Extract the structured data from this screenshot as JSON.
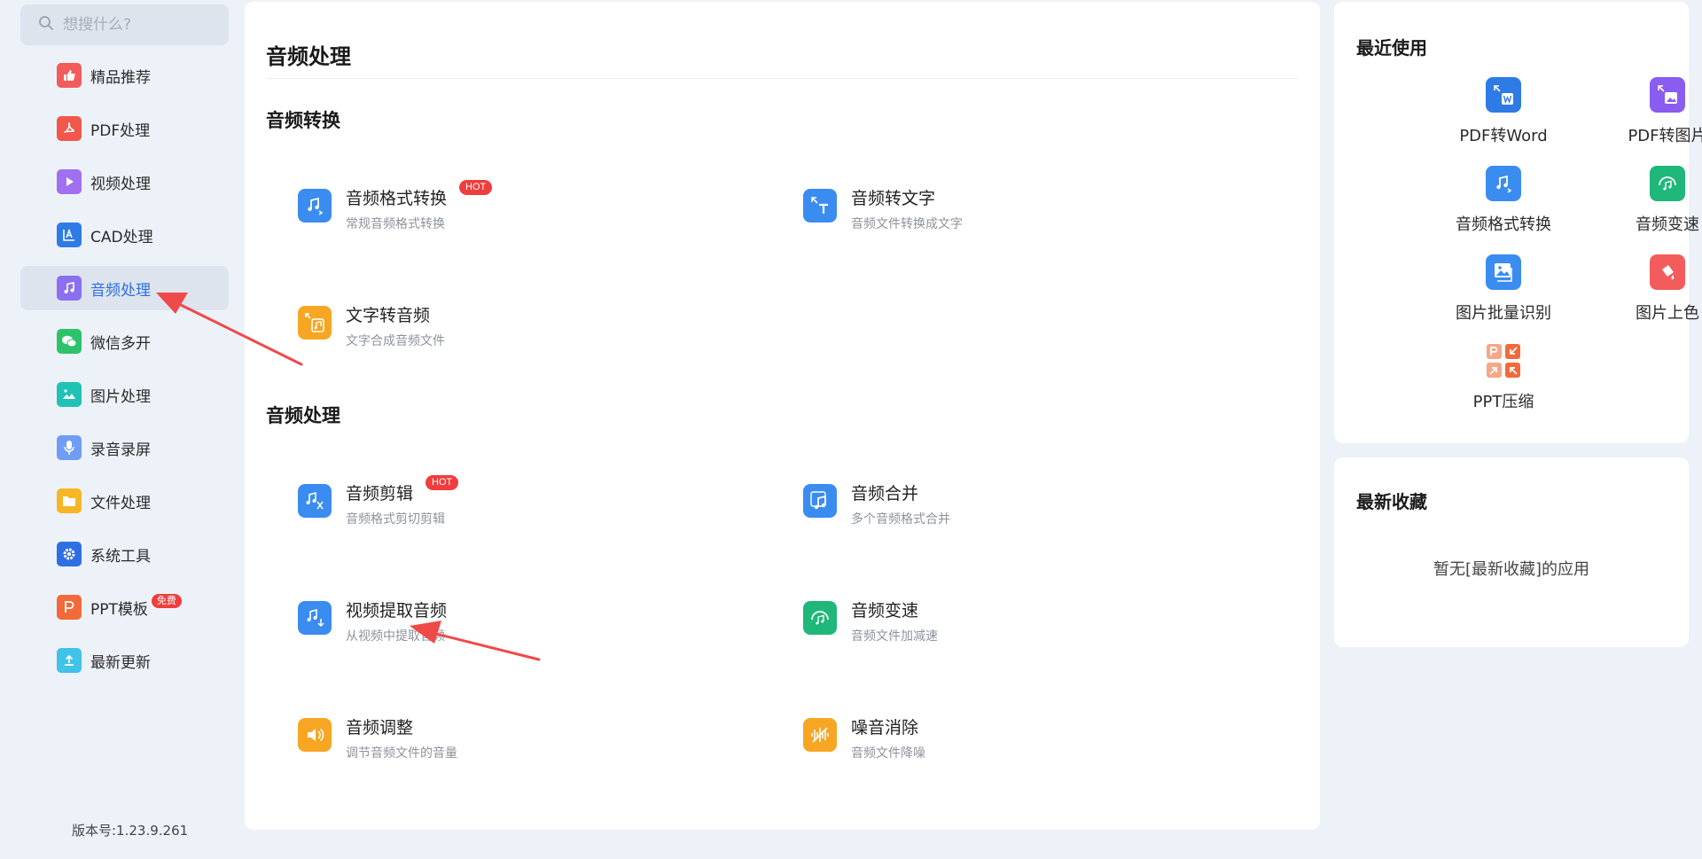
{
  "search": {
    "placeholder": "想搜什么?"
  },
  "sidebar": {
    "items": [
      {
        "label": "精品推荐",
        "icon": "thumbs-up-icon",
        "color": "#f25c5c"
      },
      {
        "label": "PDF处理",
        "icon": "pdf-icon",
        "color": "#f2574b"
      },
      {
        "label": "视频处理",
        "icon": "play-icon",
        "color": "#a070f0"
      },
      {
        "label": "CAD处理",
        "icon": "cad-icon",
        "color": "#2f7be6"
      },
      {
        "label": "音频处理",
        "icon": "music-icon",
        "color": "#8a6ff0",
        "active": true
      },
      {
        "label": "微信多开",
        "icon": "wechat-icon",
        "color": "#2ec36b"
      },
      {
        "label": "图片处理",
        "icon": "image-icon",
        "color": "#20c2b5"
      },
      {
        "label": "录音录屏",
        "icon": "microphone-icon",
        "color": "#6f9cf5"
      },
      {
        "label": "文件处理",
        "icon": "folder-icon",
        "color": "#f7b626"
      },
      {
        "label": "系统工具",
        "icon": "gear-icon",
        "color": "#2f6fe4"
      },
      {
        "label": "PPT模板",
        "icon": "ppt-icon",
        "color": "#f26a3a",
        "badge": "免费"
      },
      {
        "label": "最新更新",
        "icon": "upload-icon",
        "color": "#3fc3e8"
      }
    ],
    "version": "版本号:1.23.9.261"
  },
  "main": {
    "title": "音频处理",
    "sections": [
      {
        "title": "音频转换",
        "tools": [
          {
            "name": "音频格式转换",
            "desc": "常规音频格式转换",
            "badge": "HOT",
            "icon": "audio-convert-icon",
            "color": "#3a8cf0"
          },
          {
            "name": "音频转文字",
            "desc": "音频文件转换成文字",
            "icon": "audio-to-text-icon",
            "color": "#3a8cf0"
          },
          {
            "name": "文字转音频",
            "desc": "文字合成音频文件",
            "icon": "text-to-audio-icon",
            "color": "#f7a623"
          }
        ]
      },
      {
        "title": "音频处理",
        "tools": [
          {
            "name": "音频剪辑",
            "desc": "音频格式剪切剪辑",
            "badge": "HOT",
            "icon": "audio-cut-icon",
            "color": "#3a8cf0"
          },
          {
            "name": "音频合并",
            "desc": "多个音频格式合并",
            "icon": "audio-merge-icon",
            "color": "#3a8cf0"
          },
          {
            "name": "视频提取音频",
            "desc": "从视频中提取音频",
            "icon": "video-extract-audio-icon",
            "color": "#3a8cf0"
          },
          {
            "name": "音频变速",
            "desc": "音频文件加减速",
            "icon": "audio-speed-icon",
            "color": "#1fb77a"
          },
          {
            "name": "音频调整",
            "desc": "调节音频文件的音量",
            "icon": "volume-icon",
            "color": "#f7a623"
          },
          {
            "name": "噪音消除",
            "desc": "音频文件降噪",
            "icon": "noise-reduce-icon",
            "color": "#f7a623"
          }
        ]
      }
    ]
  },
  "recent": {
    "title": "最近使用",
    "items": [
      {
        "label": "PDF转Word",
        "icon": "pdf-to-word-icon",
        "color": "#2f7be6"
      },
      {
        "label": "PDF转图片",
        "icon": "pdf-to-image-icon",
        "color": "#8a5cf0"
      },
      {
        "label": "音频格式转换",
        "icon": "audio-convert-icon",
        "color": "#3a8cf0"
      },
      {
        "label": "音频变速",
        "icon": "audio-speed-icon",
        "color": "#1fb77a"
      },
      {
        "label": "图片批量识别",
        "icon": "image-batch-icon",
        "color": "#3a8cf0"
      },
      {
        "label": "图片上色",
        "icon": "image-colorize-icon",
        "color": "#f25c5c"
      },
      {
        "label": "PPT压缩",
        "icon": "ppt-compress-icon",
        "color": "#f28a5c"
      }
    ]
  },
  "favorites": {
    "title": "最新收藏",
    "empty": "暂无[最新收藏]的应用"
  }
}
